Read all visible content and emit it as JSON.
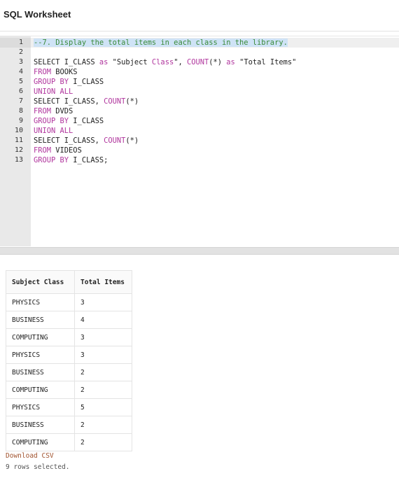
{
  "page": {
    "title": "SQL Worksheet"
  },
  "editor": {
    "lines": [
      {
        "num": "1",
        "tokens": [
          {
            "t": "--7. Display the total items in each class in the library.",
            "c": "cm"
          }
        ]
      },
      {
        "num": "2",
        "tokens": []
      },
      {
        "num": "3",
        "tokens": [
          {
            "t": "SELECT I_CLASS ",
            "c": ""
          },
          {
            "t": "as",
            "c": "kw"
          },
          {
            "t": " \"Subject ",
            "c": ""
          },
          {
            "t": "Class",
            "c": "kw"
          },
          {
            "t": "\", ",
            "c": ""
          },
          {
            "t": "COUNT",
            "c": "kw"
          },
          {
            "t": "(*) ",
            "c": ""
          },
          {
            "t": "as",
            "c": "kw"
          },
          {
            "t": " \"Total Items\"",
            "c": ""
          }
        ]
      },
      {
        "num": "4",
        "tokens": [
          {
            "t": "FROM",
            "c": "kw"
          },
          {
            "t": " BOOKS",
            "c": ""
          }
        ]
      },
      {
        "num": "5",
        "tokens": [
          {
            "t": "GROUP BY",
            "c": "kw"
          },
          {
            "t": " I_CLASS",
            "c": ""
          }
        ]
      },
      {
        "num": "6",
        "tokens": [
          {
            "t": "UNION ALL",
            "c": "kw"
          }
        ]
      },
      {
        "num": "7",
        "tokens": [
          {
            "t": "SELECT I_CLASS, ",
            "c": ""
          },
          {
            "t": "COUNT",
            "c": "kw"
          },
          {
            "t": "(*)",
            "c": ""
          }
        ]
      },
      {
        "num": "8",
        "tokens": [
          {
            "t": "FROM",
            "c": "kw"
          },
          {
            "t": " DVDS",
            "c": ""
          }
        ]
      },
      {
        "num": "9",
        "tokens": [
          {
            "t": "GROUP BY",
            "c": "kw"
          },
          {
            "t": " I_CLASS",
            "c": ""
          }
        ]
      },
      {
        "num": "10",
        "tokens": [
          {
            "t": "UNION ALL",
            "c": "kw"
          }
        ]
      },
      {
        "num": "11",
        "tokens": [
          {
            "t": "SELECT I_CLASS, ",
            "c": ""
          },
          {
            "t": "COUNT",
            "c": "kw"
          },
          {
            "t": "(*)",
            "c": ""
          }
        ]
      },
      {
        "num": "12",
        "tokens": [
          {
            "t": "FROM",
            "c": "kw"
          },
          {
            "t": " VIDEOS",
            "c": ""
          }
        ]
      },
      {
        "num": "13",
        "tokens": [
          {
            "t": "GROUP BY",
            "c": "kw"
          },
          {
            "t": " I_CLASS;",
            "c": ""
          }
        ]
      }
    ]
  },
  "results": {
    "columns": [
      "Subject Class",
      "Total Items"
    ],
    "rows": [
      [
        "PHYSICS",
        "3"
      ],
      [
        "BUSINESS",
        "4"
      ],
      [
        "COMPUTING",
        "3"
      ],
      [
        "PHYSICS",
        "3"
      ],
      [
        "BUSINESS",
        "2"
      ],
      [
        "COMPUTING",
        "2"
      ],
      [
        "PHYSICS",
        "5"
      ],
      [
        "BUSINESS",
        "2"
      ],
      [
        "COMPUTING",
        "2"
      ]
    ],
    "download_label": "Download CSV",
    "status": "9 rows selected."
  }
}
